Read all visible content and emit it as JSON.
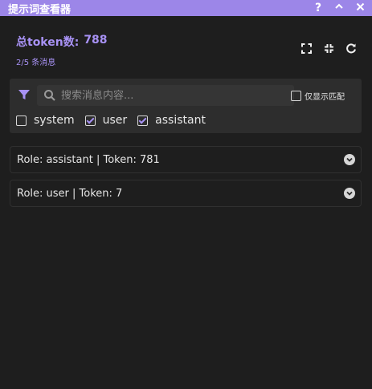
{
  "window": {
    "title": "提示词查看器",
    "controls": {
      "help": "?",
      "collapse": "^",
      "close": "✕"
    }
  },
  "header": {
    "total_label": "总token数:",
    "total_value": "788",
    "subtitle": "2/5 条消息"
  },
  "header_actions": [
    "expand-icon",
    "collapse-icon",
    "refresh-icon"
  ],
  "filter": {
    "search_placeholder": "搜索消息内容...",
    "search_value": "",
    "exact_match_label": "仅显示匹配",
    "exact_match_checked": false,
    "roles": [
      {
        "label": "system",
        "checked": false
      },
      {
        "label": "user",
        "checked": true
      },
      {
        "label": "assistant",
        "checked": true
      }
    ]
  },
  "messages": [
    {
      "label": "Role: assistant | Token: 781"
    },
    {
      "label": "Role: user | Token: 7"
    }
  ],
  "colors": {
    "accent": "#a892f5",
    "titlebar": "#9c86e8",
    "background": "#1e1e1e",
    "panel": "#2d2d2d"
  }
}
